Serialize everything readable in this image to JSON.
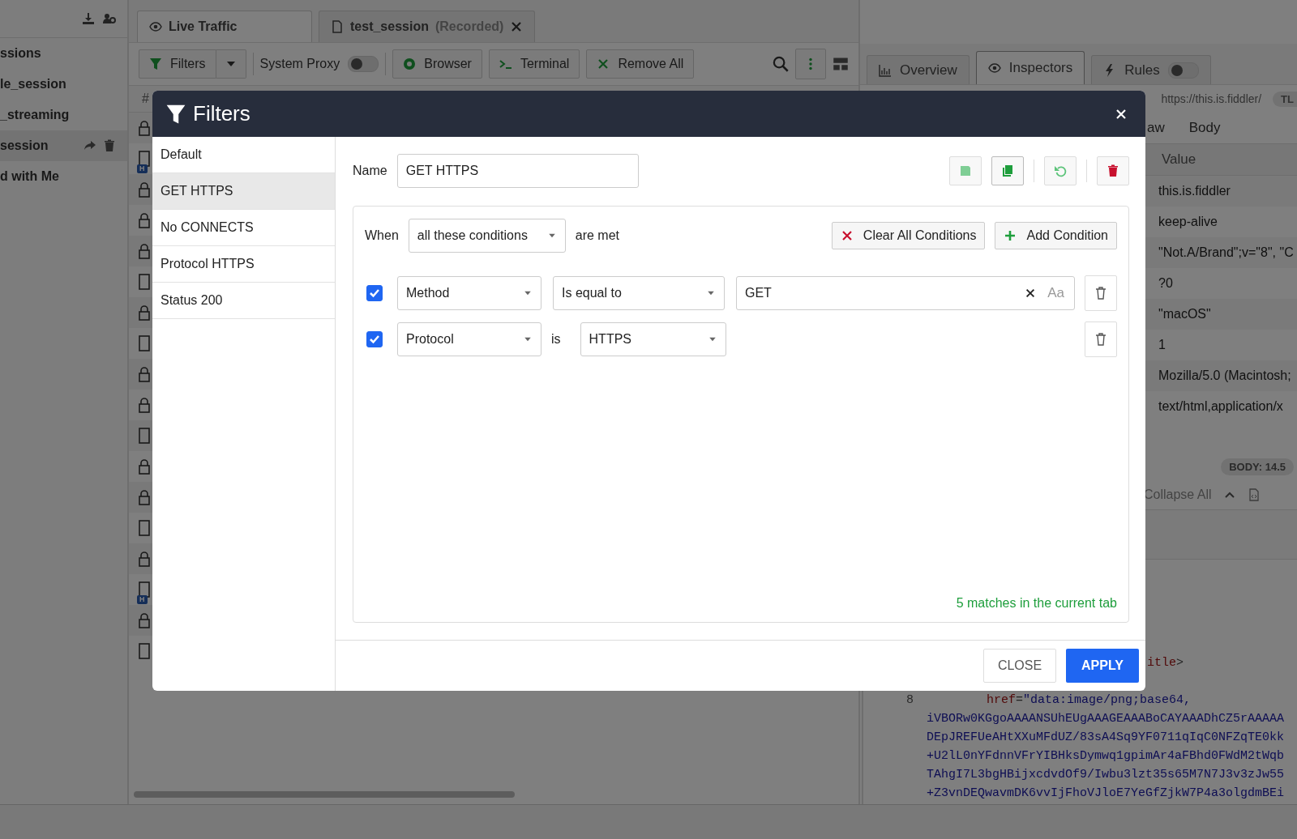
{
  "sidebar": {
    "items": [
      {
        "label": "ssions",
        "selected": false
      },
      {
        "label": "le_session",
        "selected": false
      },
      {
        "label": "_streaming",
        "selected": false
      },
      {
        "label": "session",
        "selected": true
      },
      {
        "label": "d with Me",
        "selected": false
      }
    ]
  },
  "session_tabs": [
    {
      "kind": "live",
      "label": "Live Traffic",
      "selected": true
    },
    {
      "kind": "file",
      "label": "test_session",
      "note": "(Recorded)",
      "selected": false
    }
  ],
  "toolbar": {
    "filters": "Filters",
    "system_proxy": {
      "label": "System Proxy",
      "on": false
    },
    "buttons": [
      {
        "kind": "browser",
        "label": "Browser"
      },
      {
        "kind": "terminal",
        "label": "Terminal"
      },
      {
        "kind": "remove",
        "label": "Remove All"
      }
    ]
  },
  "sessions_table": {
    "column_1": "#",
    "rows": [
      {
        "kind": "lock"
      },
      {
        "kind": "doc",
        "badge": "H"
      },
      {
        "kind": "lock"
      },
      {
        "kind": "lock"
      },
      {
        "kind": "lock"
      },
      {
        "kind": "doc"
      },
      {
        "kind": "lock"
      },
      {
        "kind": "doc"
      },
      {
        "kind": "lock"
      },
      {
        "kind": "lock"
      },
      {
        "kind": "doc"
      },
      {
        "kind": "lock"
      },
      {
        "kind": "lock"
      },
      {
        "kind": "doc"
      },
      {
        "kind": "lock"
      },
      {
        "kind": "doc",
        "badge": "H"
      },
      {
        "kind": "lock"
      },
      {
        "kind": "doc"
      }
    ]
  },
  "inspector": {
    "tabs": [
      {
        "kind": "overview",
        "label": "Overview",
        "selected": false
      },
      {
        "kind": "inspectors",
        "label": "Inspectors",
        "selected": true
      },
      {
        "kind": "rules",
        "label": "Rules",
        "selected": false,
        "on": false
      }
    ],
    "url": "https://this.is.fiddler/",
    "tls_badge": "TL",
    "subtabs": [
      "aw",
      "Body"
    ],
    "headers": {
      "column_2": "Value",
      "values": [
        "this.is.fiddler",
        "keep-alive",
        "\"Not.A/Brand\";v=\"8\", \"C",
        "?0",
        "\"macOS\"",
        "1",
        "Mozilla/5.0 (Macintosh;",
        "text/html,application/x"
      ]
    },
    "body_badge": "BODY: 14.5",
    "collapse": "Collapse All",
    "code": [
      {
        "kind": "tag_line",
        "tokens": [
          {
            "kind": "tag",
            "text": "itle"
          },
          {
            "kind": "punct",
            "text": ">"
          }
        ]
      },
      {
        "kind": "attr_line",
        "number": "8",
        "tokens": [
          {
            "kind": "tag",
            "text": "href"
          },
          {
            "kind": "punct",
            "text": "="
          },
          {
            "kind": "string",
            "text": "\"data:image/png;base64,"
          }
        ]
      },
      {
        "kind": "data_line",
        "tokens": [
          {
            "kind": "string",
            "text": "iVBORw0KGgoAAAANSUhEUgAAAGEAAABoCAYAAADhCZ5rAAAAA"
          }
        ]
      },
      {
        "kind": "data_line",
        "tokens": [
          {
            "kind": "string",
            "text": "DEpJREFUeAHtXXuMFdUZ/83sA4Sq9YF0711qIqC0NFZqTE0kk"
          }
        ]
      },
      {
        "kind": "data_line",
        "tokens": [
          {
            "kind": "string",
            "text": "+U2lL0nYFdnnVFrYIBHksDymwq1gpimAr4aFBhd0FWdM2tWqb"
          }
        ]
      },
      {
        "kind": "data_line",
        "tokens": [
          {
            "kind": "string",
            "text": "TAhgI7L3bgHBijxcdvdOf9/Iwbu3lzt35s65M7N7J3v3zJw55"
          }
        ]
      },
      {
        "kind": "data_line",
        "tokens": [
          {
            "kind": "string",
            "text": "+Z3vnDEQwavmDK6vvIjFhoVJloE7YeGfZjkW7P4a3olgdmBEi"
          }
        ]
      }
    ]
  },
  "filters_dialog": {
    "title": "Filters",
    "presets": [
      {
        "label": "Default",
        "selected": false
      },
      {
        "label": "GET HTTPS",
        "selected": true
      },
      {
        "label": "No CONNECTS",
        "selected": false
      },
      {
        "label": "Protocol HTTPS",
        "selected": false
      },
      {
        "label": "Status 200",
        "selected": false
      }
    ],
    "name_label": "Name",
    "name": "GET HTTPS",
    "when_label": "When",
    "match_mode": "all these conditions",
    "are_met": "are met",
    "clear_all": "Clear All Conditions",
    "add_condition": "Add Condition",
    "conditions": [
      {
        "kind": "compare",
        "checked": true,
        "field": "Method",
        "operator": "Is equal to",
        "value": "GET",
        "match_case": "Aa"
      },
      {
        "kind": "choice",
        "checked": true,
        "field": "Protocol",
        "connector": "is",
        "choice": "HTTPS"
      }
    ],
    "matches": "5 matches in the current tab",
    "close": "CLOSE",
    "apply": "APPLY"
  }
}
